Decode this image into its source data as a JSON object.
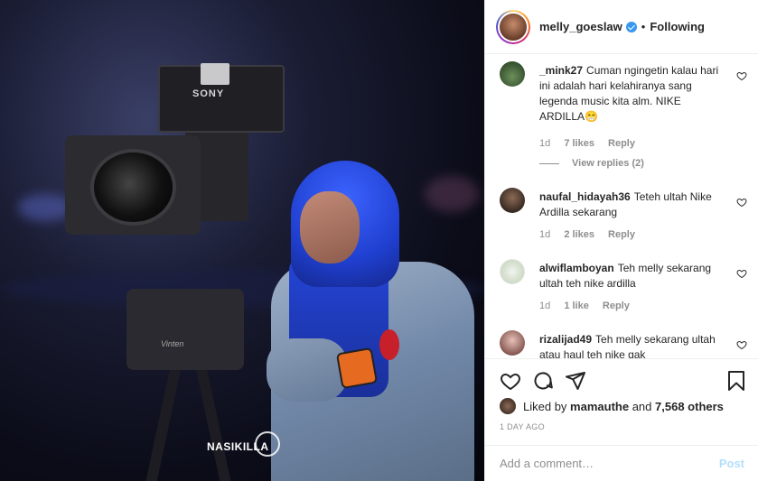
{
  "photo": {
    "camera_brand": "SONY",
    "tripod_brand": "Vinten",
    "watermark": "NASIKILLA"
  },
  "header": {
    "username": "melly_goeslaw",
    "separator": "•",
    "follow_status": "Following"
  },
  "comments": [
    {
      "username": "_mink27",
      "text": "Cuman ngingetin kalau hari ini adalah hari kelahiranya sang legenda music kita alm. NIKE ARDILLA😁",
      "age": "1d",
      "likes": "7 likes",
      "reply_label": "Reply",
      "view_replies": "View replies (2)"
    },
    {
      "username": "naufal_hidayah36",
      "text": "Teteh ultah Nike Ardilla sekarang",
      "age": "1d",
      "likes": "2 likes",
      "reply_label": "Reply"
    },
    {
      "username": "alwiflamboyan",
      "text": "Teh melly sekarang ultah teh nike ardilla",
      "age": "1d",
      "likes": "1 like",
      "reply_label": "Reply"
    },
    {
      "username": "rizalijad49",
      "text": "Teh melly sekarang ultah atau haul teh nike gak",
      "age": "",
      "likes": "",
      "reply_label": ""
    }
  ],
  "likes_summary": {
    "prefix": "Liked by",
    "user": "mamauthe",
    "connector": "and",
    "others": "7,568 others"
  },
  "time_ago": "1 DAY AGO",
  "add_comment": {
    "placeholder": "Add a comment…",
    "post_label": "Post"
  },
  "colors": {
    "verified": "#3897f0",
    "post_disabled": "#b2dffc",
    "muted": "#8e8e8e"
  }
}
